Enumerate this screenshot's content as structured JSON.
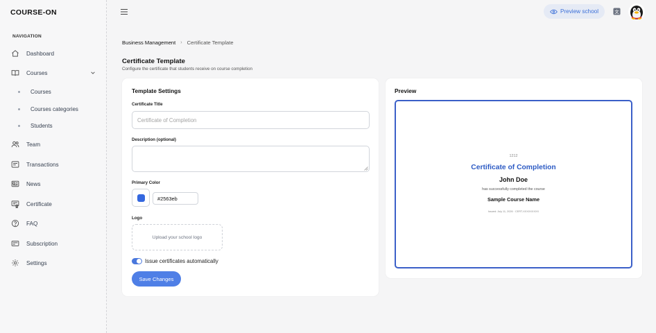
{
  "brand": {
    "logo_text": "COURSE-ON"
  },
  "sidebar": {
    "section_title": "NAVIGATION",
    "items": [
      {
        "label": "Dashboard",
        "icon": "home-icon"
      },
      {
        "label": "Courses",
        "icon": "book-icon",
        "expanded": true
      },
      {
        "label": "Team",
        "icon": "users-icon"
      },
      {
        "label": "Transactions",
        "icon": "receipt-icon"
      },
      {
        "label": "News",
        "icon": "newspaper-icon"
      },
      {
        "label": "Certificate",
        "icon": "certificate-icon"
      },
      {
        "label": "FAQ",
        "icon": "help-circle-icon"
      },
      {
        "label": "Subscription",
        "icon": "card-icon"
      },
      {
        "label": "Settings",
        "icon": "gear-icon"
      }
    ],
    "sub_items": [
      {
        "label": "Courses"
      },
      {
        "label": "Courses categories"
      },
      {
        "label": "Students"
      }
    ]
  },
  "topbar": {
    "preview_label": "Preview school",
    "lang_icon": "translate-icon",
    "avatar_icon": "penguin-avatar"
  },
  "breadcrumb": {
    "parent": "Business Management",
    "current": "Certificate Template"
  },
  "page": {
    "title": "Certificate Template",
    "subtitle": "Configure the certificate that students receive on course completion"
  },
  "settings": {
    "card_title": "Template Settings",
    "title_label": "Certificate Title",
    "title_placeholder": "Certificate of Completion",
    "title_value": "",
    "description_label": "Description (optional)",
    "description_value": "",
    "color_label": "Primary Color",
    "color_value": "#2563eb",
    "logo_label": "Logo",
    "upload_text": "Upload your school logo",
    "toggle_label": "Issue certificates automatically",
    "toggle_on": true,
    "save_label": "Save Changes"
  },
  "preview": {
    "card_title": "Preview",
    "logo_text": "1212",
    "cert_title": "Certificate of Completion",
    "student_name": "John Doe",
    "completion_text": "has successfully completed the course",
    "course_name": "Sample Course Name",
    "footer_text": "Issued: July 11, 2026 · CERT-XXXXXXXXX"
  },
  "colors": {
    "primary": "#2563eb",
    "button": "#4f7fe6",
    "toggle": "#4a78dd",
    "cert_border": "#3a5fc8",
    "cert_title": "#2d5bc4",
    "swatch": "#3568df"
  }
}
